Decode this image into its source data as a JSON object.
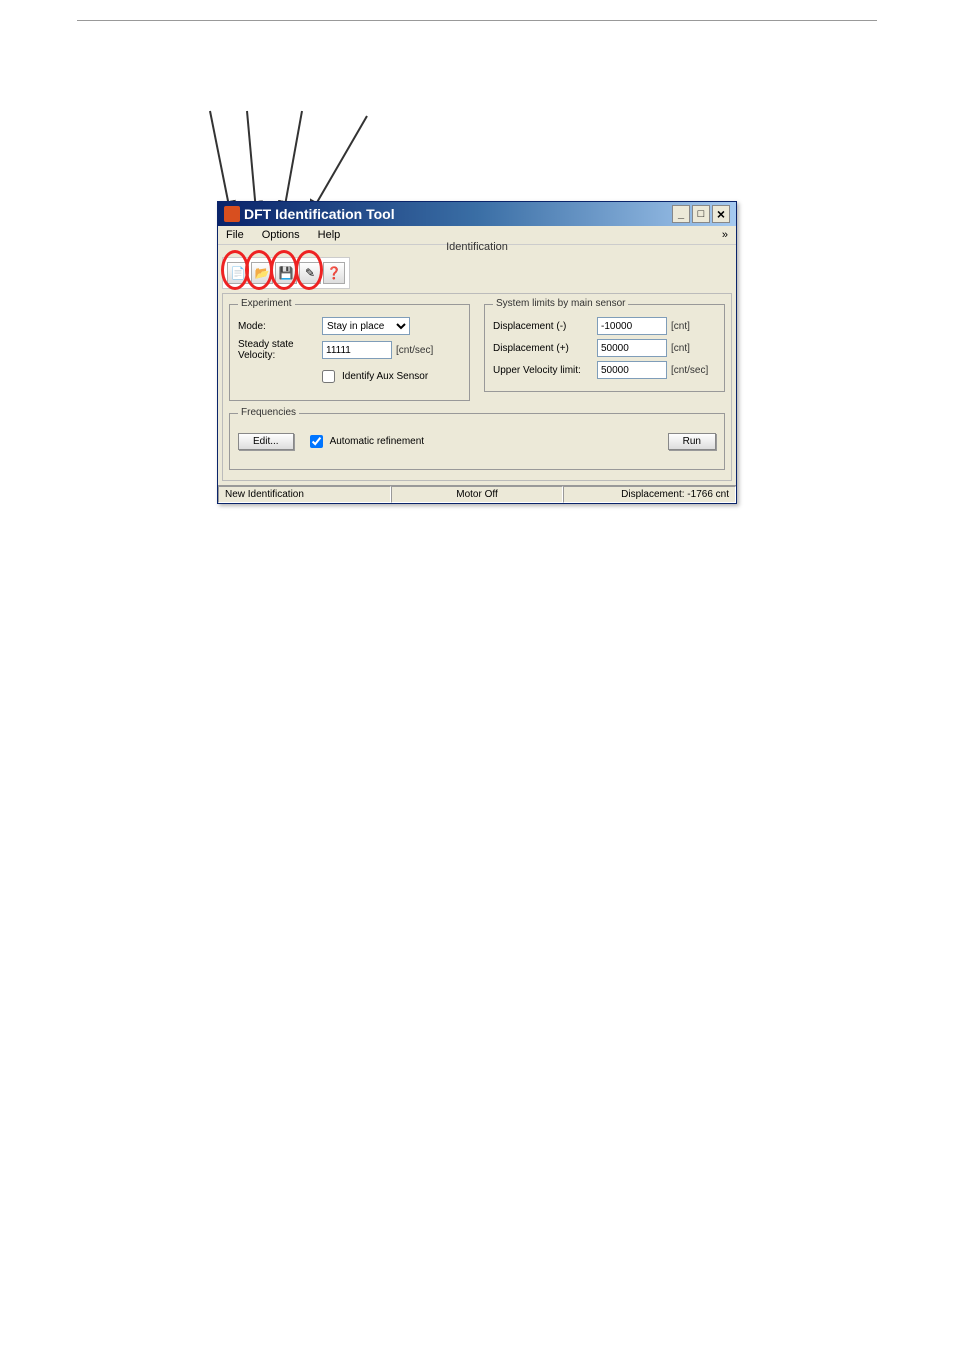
{
  "window": {
    "title": "DFT Identification Tool"
  },
  "menu": {
    "file": "File",
    "options": "Options",
    "help": "Help"
  },
  "tab": {
    "identification": "Identification"
  },
  "experiment": {
    "legend": "Experiment",
    "mode_label": "Mode:",
    "mode_value": "Stay in place",
    "velocity_label": "Steady state Velocity:",
    "velocity_value": "11111",
    "velocity_unit": "[cnt/sec]",
    "identify_aux": "Identify Aux Sensor"
  },
  "limits": {
    "legend": "System limits by main sensor",
    "disp_neg_label": "Displacement (-)",
    "disp_neg_value": "-10000",
    "disp_neg_unit": "[cnt]",
    "disp_pos_label": "Displacement (+)",
    "disp_pos_value": "50000",
    "disp_pos_unit": "[cnt]",
    "vel_label": "Upper Velocity limit:",
    "vel_value": "50000",
    "vel_unit": "[cnt/sec]"
  },
  "freq": {
    "legend": "Frequencies",
    "edit_btn": "Edit...",
    "auto_refine": "Automatic refinement",
    "run_btn": "Run"
  },
  "status": {
    "left": "New Identification",
    "center": "Motor Off",
    "right": "Displacement: -1766 cnt"
  },
  "win_controls": {
    "min": "_",
    "max": "□",
    "close": "×"
  }
}
